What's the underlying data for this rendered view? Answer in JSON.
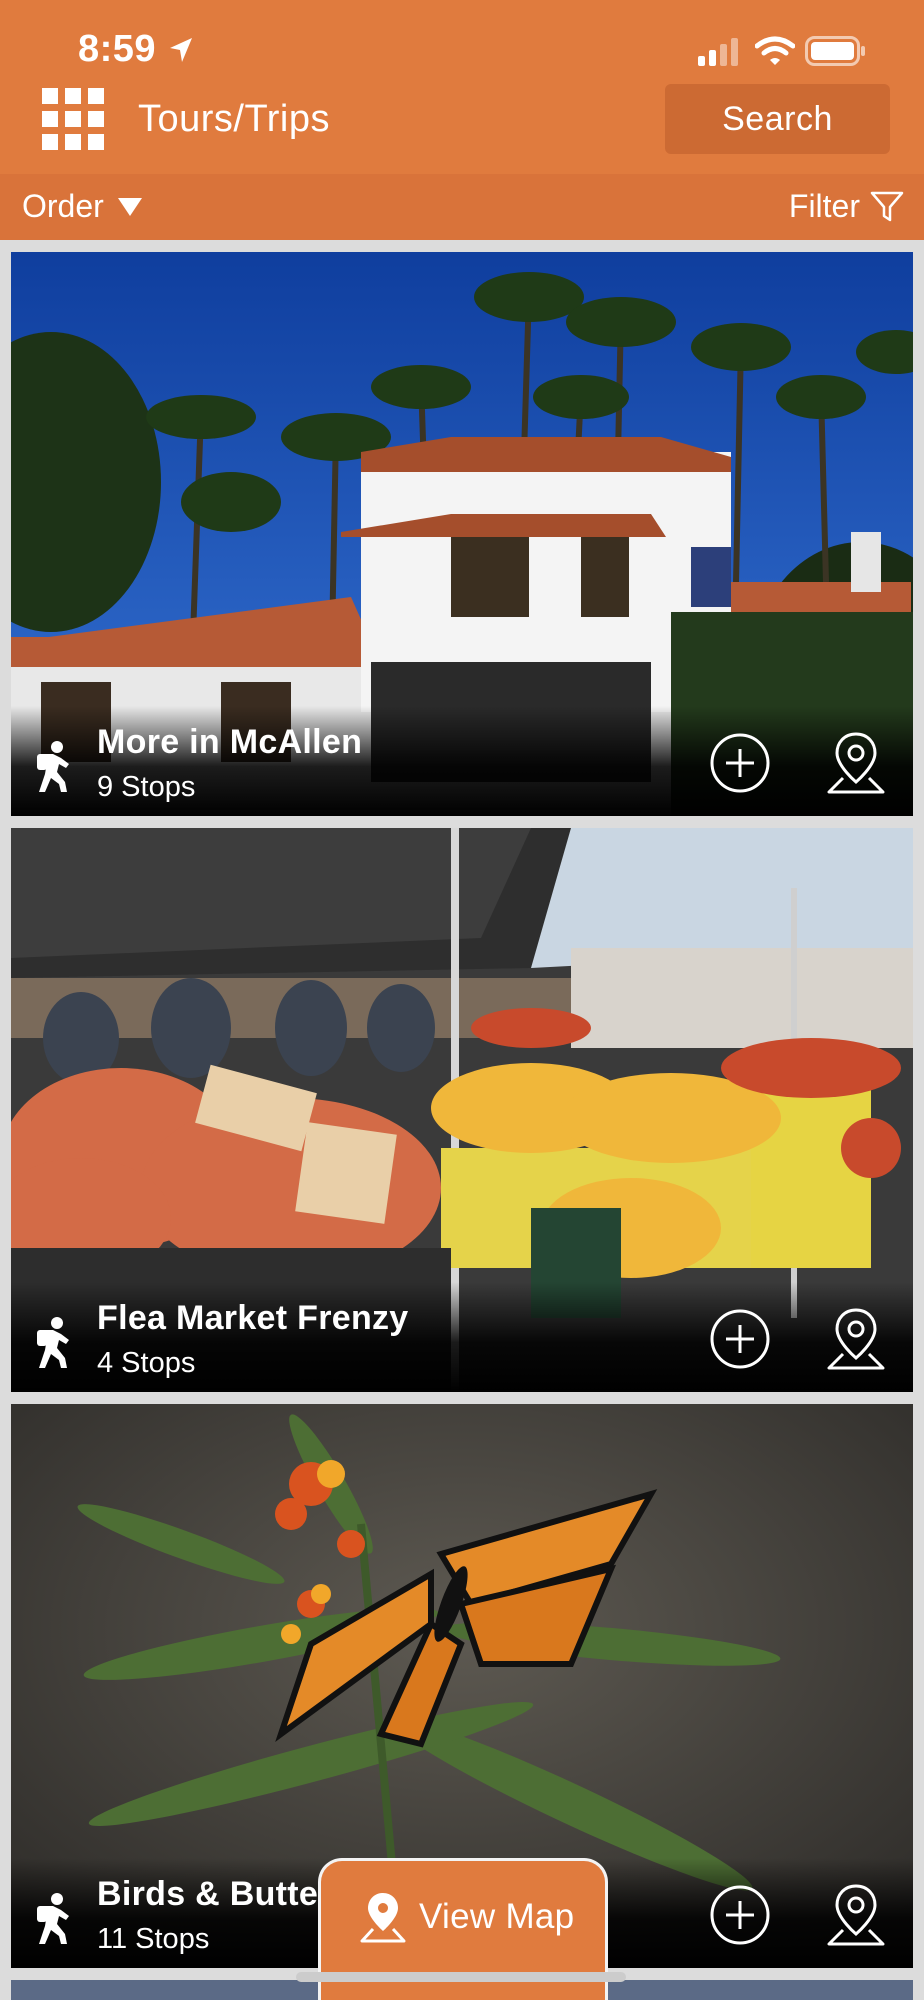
{
  "status_bar": {
    "time": "8:59"
  },
  "header": {
    "title": "Tours/Trips",
    "search_label": "Search"
  },
  "toolbar": {
    "order_label": "Order",
    "filter_label": "Filter"
  },
  "tours": [
    {
      "name": "More in McAllen",
      "stops": "9 Stops"
    },
    {
      "name": "Flea Market Frenzy",
      "stops": "4 Stops"
    },
    {
      "name": "Birds & Butte",
      "stops": "11 Stops"
    }
  ],
  "view_map": {
    "label": "View Map"
  },
  "colors": {
    "brand": "#E07B3E",
    "toolbar": "#D9733A",
    "button": "#CC6A33"
  },
  "icons": [
    "location-arrow-icon",
    "signal-icon",
    "wifi-icon",
    "battery-icon",
    "menu-grid-icon",
    "caret-down-icon",
    "filter-icon",
    "hiker-icon",
    "add-circle-icon",
    "map-pin-icon"
  ]
}
